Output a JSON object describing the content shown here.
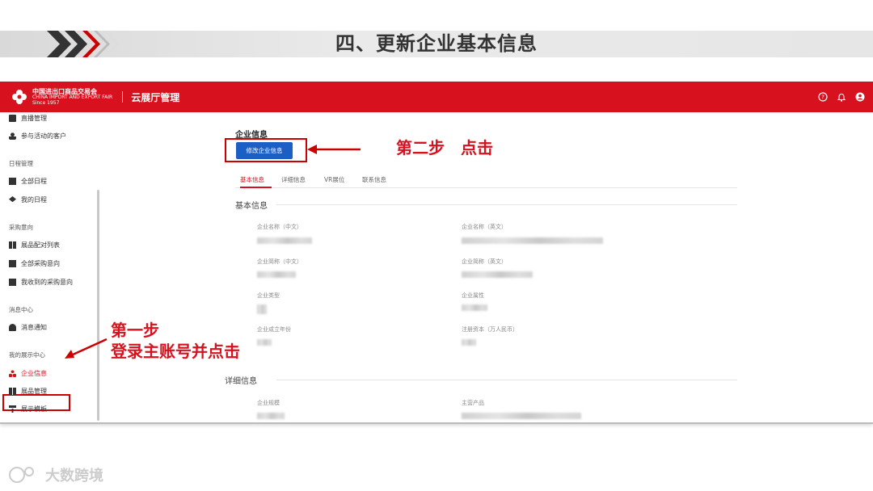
{
  "slide": {
    "title": "四、更新企业基本信息"
  },
  "app": {
    "logo_cn": "中国进出口商品交易会",
    "logo_en": "CHINA IMPORT AND EXPORT FAIR",
    "logo_since": "Since 1957",
    "title": "云展厅管理",
    "icons": [
      "help-icon",
      "bell-icon",
      "user-icon"
    ]
  },
  "sidebar": {
    "items": [
      {
        "label": "直播管理",
        "icon": "live-icon"
      },
      {
        "label": "参与活动的客户",
        "icon": "person-icon"
      },
      {
        "label": "全部日程",
        "icon": "calendar-icon"
      },
      {
        "label": "我的日程",
        "icon": "cap-icon"
      },
      {
        "label": "展品配对列表",
        "icon": "match-icon"
      },
      {
        "label": "全部采购意向",
        "icon": "list-icon"
      },
      {
        "label": "我收到的采购意向",
        "icon": "inbox-icon"
      },
      {
        "label": "消息通知",
        "icon": "bell-icon"
      },
      {
        "label": "企业信息",
        "icon": "company-icon"
      },
      {
        "label": "展品管理",
        "icon": "grid-icon"
      },
      {
        "label": "展示模板",
        "icon": "template-icon"
      }
    ],
    "headers": [
      "日程管理",
      "采购意向",
      "消息中心",
      "我的展示中心"
    ]
  },
  "main": {
    "section_title": "企业信息",
    "edit_button": "修改企业信息",
    "tabs": [
      "基本信息",
      "详细信息",
      "VR展位",
      "联系信息"
    ],
    "group_basic": "基本信息",
    "group_detail": "详细信息",
    "fields": [
      "企业名称（中文）",
      "企业名称（英文）",
      "企业简称（中文）",
      "企业简称（英文）",
      "企业类型",
      "企业属性",
      "企业成立年份",
      "注册资本（万人民币）",
      "企业规模",
      "主营产品"
    ]
  },
  "annotations": {
    "step2": "第二步　点击",
    "step1_line1": "第一步",
    "step1_line2": "登录主账号并点击"
  },
  "footer": {
    "brand": "大数跨境"
  },
  "colors": {
    "brand_red": "#d7111d",
    "button_blue": "#1c5fc4",
    "annotation_red": "#c00"
  }
}
